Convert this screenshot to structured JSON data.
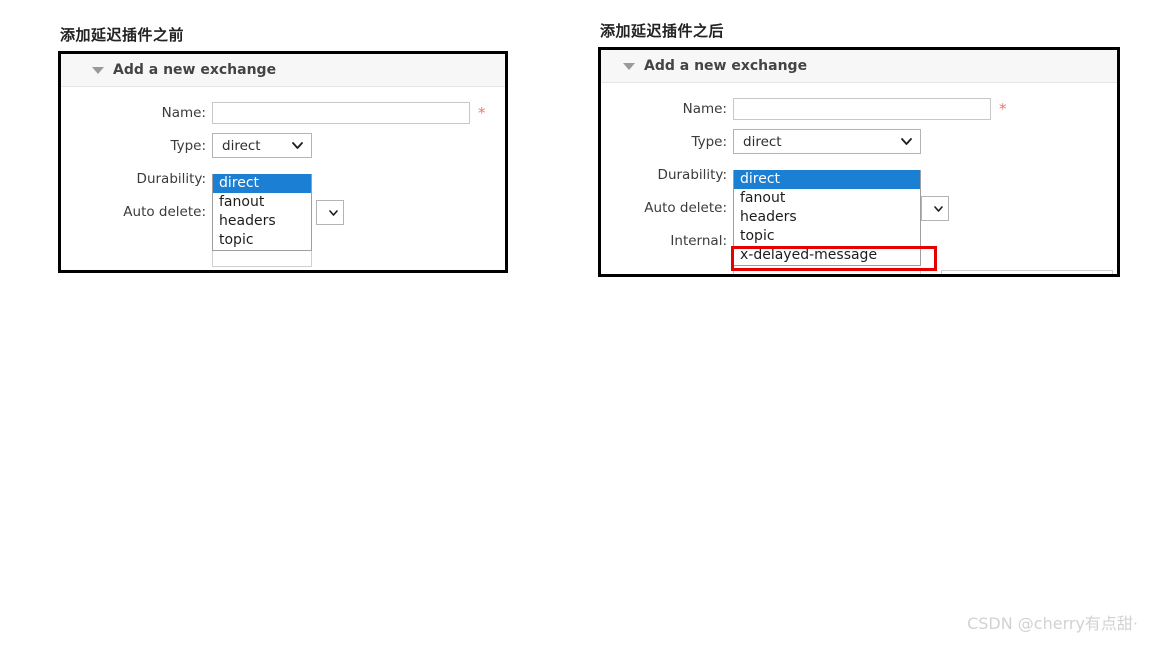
{
  "page": {
    "watermark": "CSDN @cherry有点甜·"
  },
  "figures": [
    {
      "caption": "添加延迟插件之前",
      "panel": {
        "section_title": "Add a new exchange",
        "collapse_icon": "triangle-down-icon",
        "rows": [
          {
            "label": "Name:",
            "control": "text-input",
            "value": "",
            "required_marker": "*"
          },
          {
            "label": "Type:",
            "control": "select",
            "value": "direct",
            "chevron_icon": "chevron-down-icon"
          },
          {
            "label": "Durability:",
            "control": "select-hidden",
            "value": ""
          },
          {
            "label": "Auto delete:",
            "control": "help",
            "help_badge": "?"
          }
        ],
        "dropdown": {
          "options": [
            "direct",
            "fanout",
            "headers",
            "topic"
          ],
          "selected": "direct"
        }
      }
    },
    {
      "caption": "添加延迟插件之后",
      "panel": {
        "section_title": "Add a new exchange",
        "collapse_icon": "triangle-down-icon",
        "rows": [
          {
            "label": "Name:",
            "control": "text-input",
            "value": "",
            "required_marker": "*"
          },
          {
            "label": "Type:",
            "control": "select",
            "value": "direct",
            "chevron_icon": "chevron-down-icon"
          },
          {
            "label": "Durability:",
            "control": "select-hidden",
            "value": ""
          },
          {
            "label": "Auto delete:",
            "control": "help",
            "help_badge": "?"
          },
          {
            "label": "Internal:",
            "control": "help",
            "help_badge": "?"
          }
        ],
        "dropdown": {
          "options": [
            "direct",
            "fanout",
            "headers",
            "topic",
            "x-delayed-message"
          ],
          "selected": "direct",
          "highlighted_option": "x-delayed-message"
        }
      }
    }
  ],
  "colors": {
    "selection_blue": "#1b7fd4",
    "annotation_red": "#e60000",
    "required_red": "#f2776f",
    "panel_border": "#000000",
    "header_bg": "#f7f7f7"
  }
}
